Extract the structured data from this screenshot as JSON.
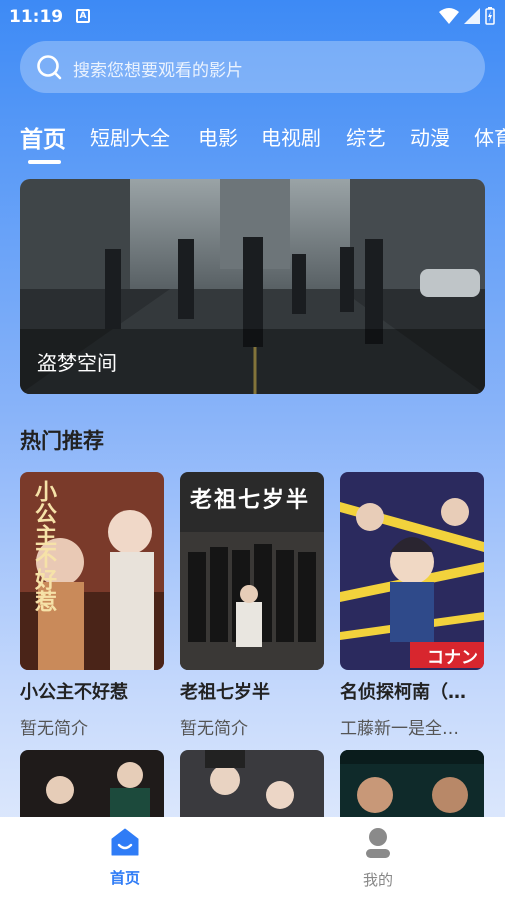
{
  "status": {
    "time": "11:19",
    "notif_letter": "A"
  },
  "search": {
    "placeholder": "搜索您想要观看的影片"
  },
  "tabs": [
    "首页",
    "短剧大全",
    "电影",
    "电视剧",
    "综艺",
    "动漫",
    "体育"
  ],
  "banner": {
    "title": "盗梦空间"
  },
  "section": {
    "title": "热门推荐"
  },
  "cards": [
    {
      "title": "小公主不好惹",
      "desc": "暂无简介",
      "poster_text": "小公主不好惹"
    },
    {
      "title": "老祖七岁半",
      "desc": "暂无简介",
      "poster_text": "老祖七岁半"
    },
    {
      "title": "名侦探柯南（…",
      "desc": "工藤新一是全…",
      "poster_text": "コナン"
    }
  ],
  "nav": {
    "home": "首页",
    "mine": "我的"
  },
  "colors": {
    "accent": "#3d8af5",
    "nav_active": "#2f7cf6",
    "nav_inactive": "#888888"
  }
}
